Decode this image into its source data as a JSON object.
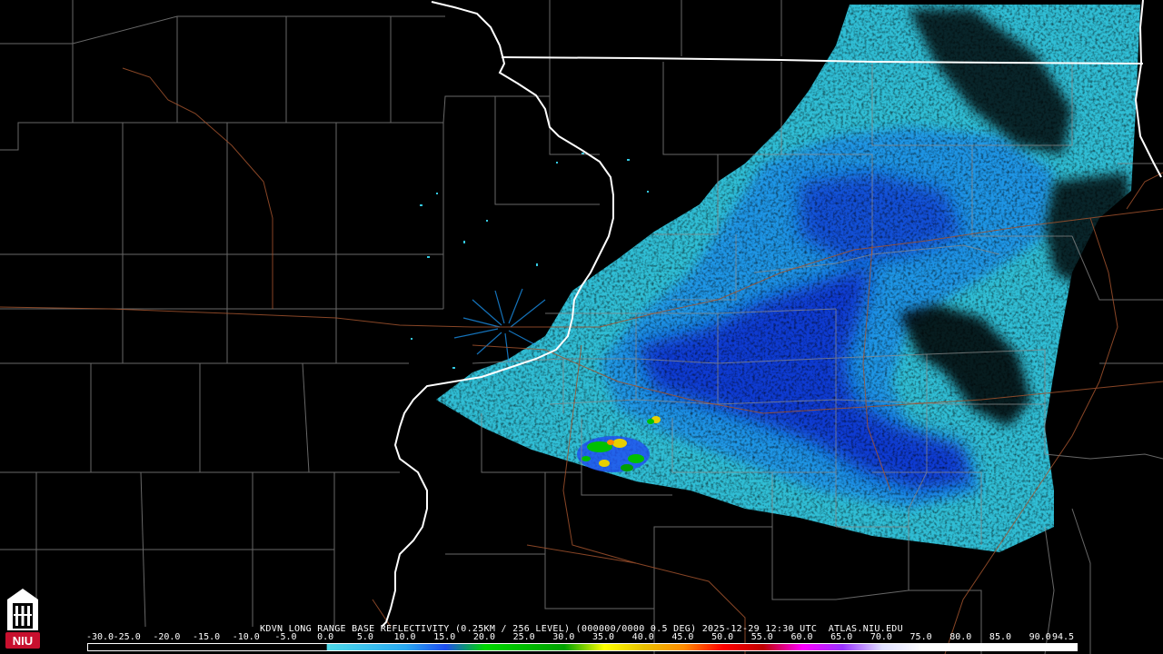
{
  "product": {
    "caption": "KDVN LONG RANGE BASE REFLECTIVITY (0.25KM / 256 LEVEL) (000000/0000 0.5 DEG) 2025-12-29 12:30 UTC  ATLAS.NIU.EDU"
  },
  "logo": {
    "text": "NIU",
    "color": "#c8102e"
  },
  "legend": {
    "labels": [
      "-30.0",
      "-25.0",
      "-20.0",
      "-15.0",
      "-10.0",
      "-5.0",
      "0.0",
      "5.0",
      "10.0",
      "15.0",
      "20.0",
      "25.0",
      "30.0",
      "35.0",
      "40.0",
      "45.0",
      "50.0",
      "55.0",
      "60.0",
      "65.0",
      "70.0",
      "75.0",
      "80.0",
      "85.0",
      "90.0",
      "94.5"
    ],
    "values": [
      -30,
      -25,
      -20,
      -15,
      -10,
      -5,
      0,
      5,
      10,
      15,
      20,
      25,
      30,
      35,
      40,
      45,
      50,
      55,
      60,
      65,
      70,
      75,
      80,
      85,
      90,
      94.5
    ],
    "min": -30,
    "max": 94.5,
    "color_stops": [
      {
        "dbz": -30,
        "color": "#000000"
      },
      {
        "dbz": 0,
        "color": "#000000"
      },
      {
        "dbz": 0.1,
        "color": "#4fd9e8"
      },
      {
        "dbz": 10,
        "color": "#29a8f0"
      },
      {
        "dbz": 15,
        "color": "#1f4ef0"
      },
      {
        "dbz": 20,
        "color": "#00d800"
      },
      {
        "dbz": 30,
        "color": "#00a000"
      },
      {
        "dbz": 35,
        "color": "#ffff00"
      },
      {
        "dbz": 40,
        "color": "#e8c000"
      },
      {
        "dbz": 45,
        "color": "#ff8c00"
      },
      {
        "dbz": 50,
        "color": "#ff0000"
      },
      {
        "dbz": 55,
        "color": "#c00000"
      },
      {
        "dbz": 60,
        "color": "#ff00ff"
      },
      {
        "dbz": 65,
        "color": "#9933ff"
      },
      {
        "dbz": 70,
        "color": "#e0e0ff"
      },
      {
        "dbz": 75,
        "color": "#ffffff"
      },
      {
        "dbz": 94.5,
        "color": "#ffffff"
      }
    ]
  },
  "map": {
    "background_color": "#000000",
    "state_border_color": "#ffffff",
    "county_line_color": "#8a8a8a",
    "road_color": "#a0522d",
    "echo_light_color": "#33c8e0",
    "echo_mid_color": "#1a8fe8",
    "echo_heavy_color": "#1030d0"
  }
}
